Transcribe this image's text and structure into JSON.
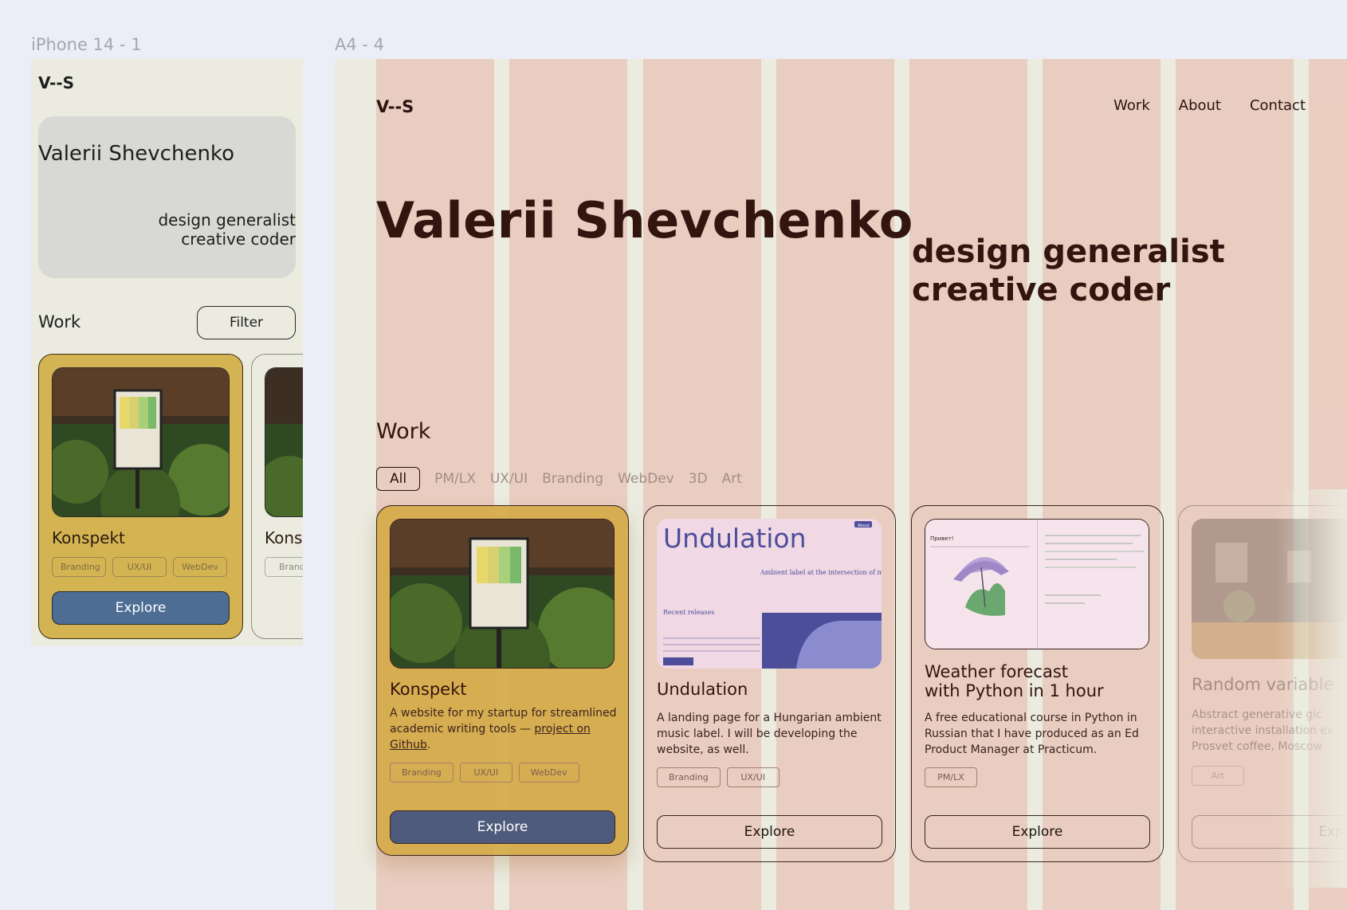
{
  "labels": {
    "phone_frame": "iPhone 14 - 1",
    "a4_frame": "A4 - 4"
  },
  "phone": {
    "logo": "V--S",
    "name": "Valerii Shevchenko",
    "tagline1": "design generalist",
    "tagline2": "creative coder",
    "work": "Work",
    "filter": "Filter",
    "cards": [
      {
        "title": "Konspekt",
        "tags": [
          "Branding",
          "UX/UI",
          "WebDev"
        ],
        "explore": "Explore"
      },
      {
        "title": "Kons",
        "tags": [
          "Branc"
        ]
      }
    ]
  },
  "a4": {
    "logo": "V--S",
    "nav": [
      "Work",
      "About",
      "Contact"
    ],
    "name": "Valerii Shevchenko",
    "tagline1": "design generalist",
    "tagline2": "creative coder",
    "work": "Work",
    "filters": [
      "All",
      "PM/LX",
      "UX/UI",
      "Branding",
      "WebDev",
      "3D",
      "Art"
    ],
    "cards": [
      {
        "title": "Konspekt",
        "desc": "A website for my startup for streamlined academic writing tools —",
        "link": "project on Github",
        "tags": [
          "Branding",
          "UX/UI",
          "WebDev"
        ],
        "explore": "Explore"
      },
      {
        "title": "Undulation",
        "desc": "A landing page for a Hungarian ambient music label. I will be developing the website, as well.",
        "tags": [
          "Branding",
          "UX/UI"
        ],
        "explore": "Explore",
        "preview": {
          "heading": "Undulation",
          "sub": "Ambient label at the intersection of meditation, psychoacoustics and experimental sound",
          "recent": "Recent releases",
          "badge": "About"
        }
      },
      {
        "title1": "Weather forecast",
        "title2": "with Python in 1 hour",
        "desc": "A free educational course in Python in Russian that I have produced as an Ed Product Manager at Practicum.",
        "tags": [
          "PM/LX"
        ],
        "explore": "Explore",
        "preview": {
          "greeting": "Привет!"
        }
      },
      {
        "title": "Random variable",
        "desc": "Abstract generative gic interactive installation ex Prosvet coffee, Moscow",
        "tags": [
          "Art"
        ],
        "explore": "Explore"
      }
    ]
  },
  "colors": {
    "page_bg": "#ebeef6",
    "frame_bg": "#ebebe0",
    "grid_col": "#e8c6b8",
    "accent_yellow": "#d4aa46",
    "button_blue": "#4f5b7c",
    "text_dark": "#33150f"
  }
}
